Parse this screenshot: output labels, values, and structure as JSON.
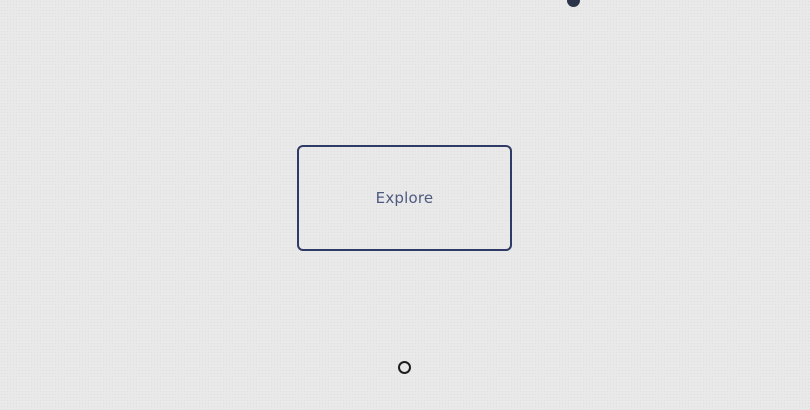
{
  "main": {
    "explore_button": {
      "label": "Explore"
    },
    "markers": {
      "top_dot_color": "#2b3448",
      "bottom_ring_color": "#1e1e1e"
    }
  },
  "colors": {
    "background": "#e9e9e9",
    "button_border": "#2f3a66",
    "button_text": "#4e5a80"
  }
}
